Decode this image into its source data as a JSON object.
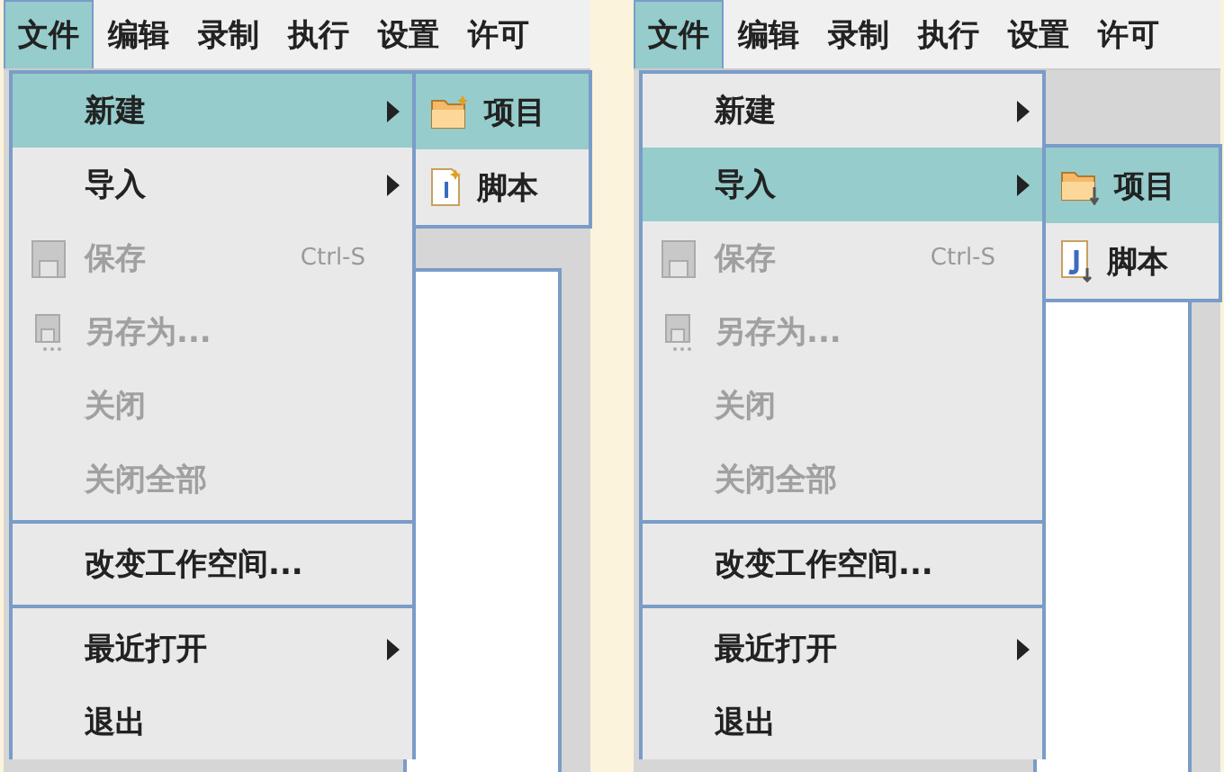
{
  "panels": [
    {
      "menubar": [
        {
          "label": "文件",
          "selected": true
        },
        {
          "label": "编辑",
          "selected": false
        },
        {
          "label": "录制",
          "selected": false
        },
        {
          "label": "执行",
          "selected": false
        },
        {
          "label": "设置",
          "selected": false
        },
        {
          "label": "许可",
          "selected": false
        }
      ],
      "menu": [
        {
          "kind": "branch",
          "label": "新建",
          "selected": true,
          "disabled": false,
          "submenu": [
            {
              "kind": "newfolder",
              "label": "项目",
              "selected": true
            },
            {
              "kind": "newscript",
              "label": "脚本",
              "selected": false
            }
          ]
        },
        {
          "kind": "branch",
          "label": "导入",
          "selected": false,
          "disabled": false
        },
        {
          "kind": "disk",
          "label": "保存",
          "selected": false,
          "disabled": true,
          "shortcut": "Ctrl-S"
        },
        {
          "kind": "diskdots",
          "label": "另存为...",
          "selected": false,
          "disabled": true
        },
        {
          "kind": "plain",
          "label": "关闭",
          "selected": false,
          "disabled": true
        },
        {
          "kind": "plain",
          "label": "关闭全部",
          "selected": false,
          "disabled": true
        },
        {
          "kind": "separator"
        },
        {
          "kind": "plain",
          "label": "改变工作空间...",
          "selected": false,
          "disabled": false
        },
        {
          "kind": "separator"
        },
        {
          "kind": "branch",
          "label": "最近打开",
          "selected": false,
          "disabled": false
        },
        {
          "kind": "plain",
          "label": "退出",
          "selected": false,
          "disabled": false
        }
      ]
    },
    {
      "menubar": [
        {
          "label": "文件",
          "selected": true
        },
        {
          "label": "编辑",
          "selected": false
        },
        {
          "label": "录制",
          "selected": false
        },
        {
          "label": "执行",
          "selected": false
        },
        {
          "label": "设置",
          "selected": false
        },
        {
          "label": "许可",
          "selected": false
        }
      ],
      "menu": [
        {
          "kind": "branch",
          "label": "新建",
          "selected": false,
          "disabled": false
        },
        {
          "kind": "branch",
          "label": "导入",
          "selected": true,
          "disabled": false,
          "submenu": [
            {
              "kind": "importfolder",
              "label": "项目",
              "selected": true
            },
            {
              "kind": "importscript",
              "label": "脚本",
              "selected": false
            }
          ]
        },
        {
          "kind": "disk",
          "label": "保存",
          "selected": false,
          "disabled": true,
          "shortcut": "Ctrl-S"
        },
        {
          "kind": "diskdots",
          "label": "另存为...",
          "selected": false,
          "disabled": true
        },
        {
          "kind": "plain",
          "label": "关闭",
          "selected": false,
          "disabled": true
        },
        {
          "kind": "plain",
          "label": "关闭全部",
          "selected": false,
          "disabled": true
        },
        {
          "kind": "separator"
        },
        {
          "kind": "plain",
          "label": "改变工作空间...",
          "selected": false,
          "disabled": false
        },
        {
          "kind": "separator"
        },
        {
          "kind": "branch",
          "label": "最近打开",
          "selected": false,
          "disabled": false
        },
        {
          "kind": "plain",
          "label": "退出",
          "selected": false,
          "disabled": false
        }
      ]
    }
  ]
}
